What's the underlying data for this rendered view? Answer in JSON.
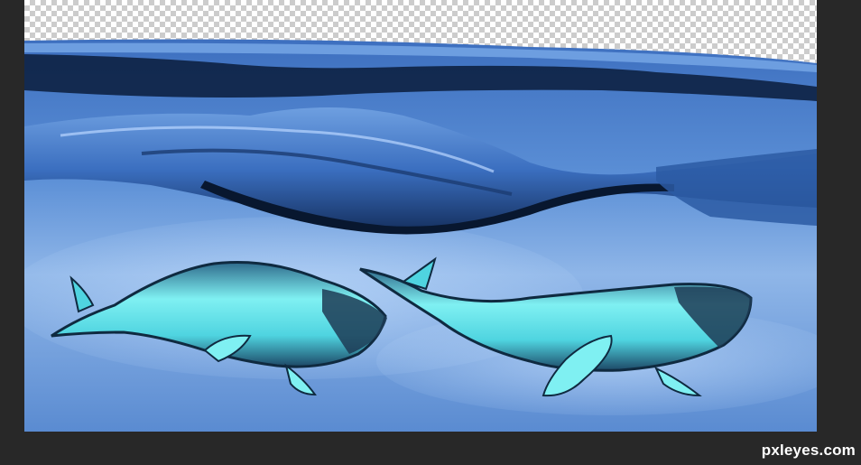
{
  "document": {
    "watermark": "pxleyes.com"
  },
  "colors": {
    "app_background": "#282828",
    "water_light": "#8fb6e8",
    "water_mid": "#4f84cf",
    "water_dark": "#0d2142",
    "whale_glow": "#6fe8ee",
    "whale_dark": "#1a3a55"
  },
  "icons": {
    "canvas_layer": "transparency-checkerboard"
  }
}
